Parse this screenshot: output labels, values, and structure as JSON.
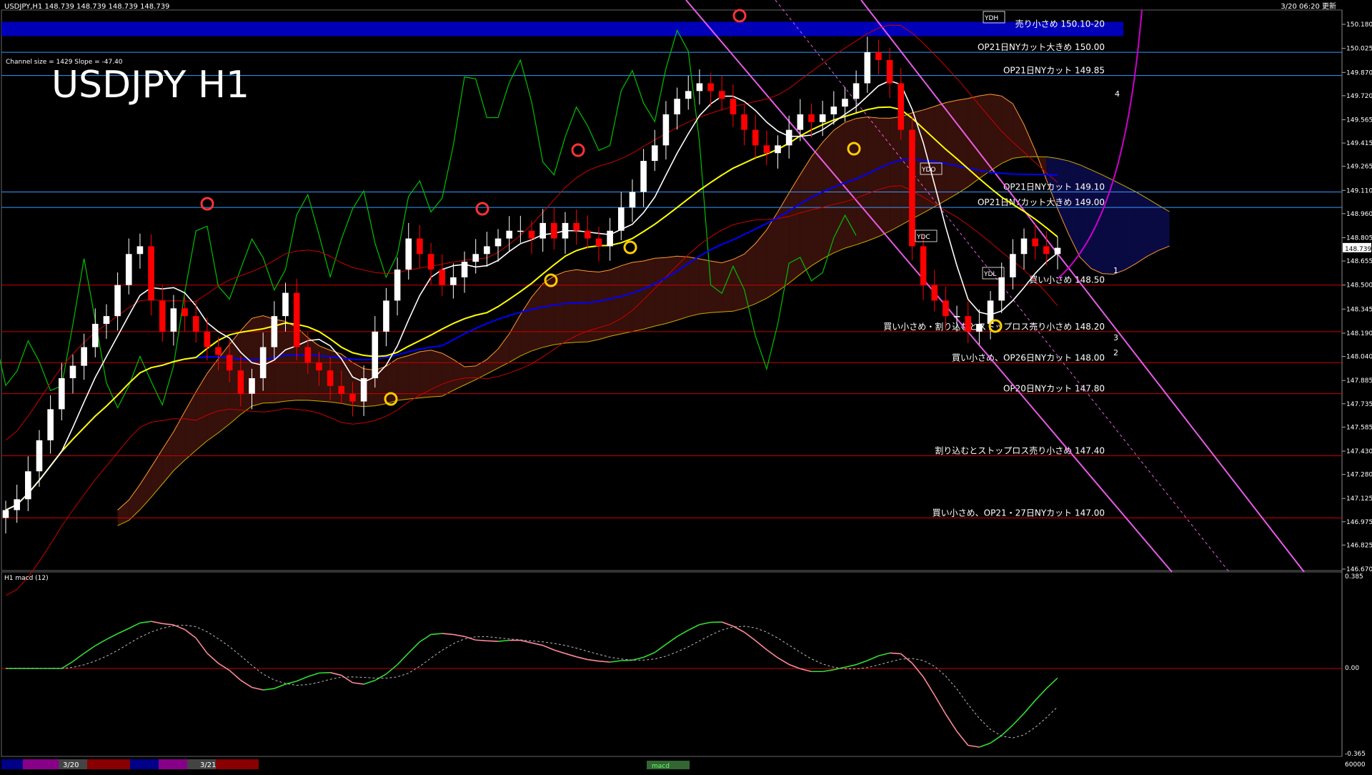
{
  "window": {
    "symbol_header": "USDJPY,H1  148.739 148.739 148.739 148.739",
    "timestamp": "3/20 06:20 更新",
    "channel_info": "Channel size = 1429  Slope = -47.40",
    "big_title": "USDJPY H1"
  },
  "macd_panel": {
    "label": "H1  macd (12)",
    "scale": [
      "0.385",
      "0.00",
      "-0.365"
    ],
    "volume_label": "60000"
  },
  "bottom_bar": {
    "date_labels": [
      "3/20",
      "3/21"
    ],
    "tab_label": "macd"
  },
  "colors": {
    "background": "#000000",
    "bull_candle": "#ffffff",
    "bear_candle": "#ff0000",
    "ma_fast": "#ffffff",
    "ma_mid": "#ffff00",
    "ma_slow": "#0000ff",
    "chikou": "#00c000",
    "channel": "#ff66ff",
    "macd_up": "#33dd33",
    "macd_down": "#ff8899",
    "signal": "#bbbbbb",
    "band_blue": "#0000cc"
  },
  "chart_data": {
    "type": "candlestick",
    "symbol": "USDJPY",
    "timeframe": "H1",
    "ylim": [
      146.67,
      150.18
    ],
    "y_ticks": [
      "150.180",
      "150.025",
      "149.870",
      "149.720",
      "149.565",
      "149.415",
      "149.265",
      "149.110",
      "148.960",
      "148.805",
      "148.655",
      "148.500",
      "148.345",
      "148.190",
      "148.040",
      "147.885",
      "147.735",
      "147.585",
      "147.430",
      "147.280",
      "147.125",
      "146.975",
      "146.825",
      "146.670"
    ],
    "current_price": "148.739",
    "levels": [
      {
        "price": 150.15,
        "text": "売り小さめ 150.10-20",
        "color": "#ffffff",
        "band": true
      },
      {
        "price": 150.0,
        "text": "OP21日NYカット大きめ 150.00",
        "color": "#3399ff"
      },
      {
        "price": 149.85,
        "text": "OP21日NYカット 149.85",
        "color": "#3399ff"
      },
      {
        "price": 149.1,
        "text": "OP21日NYカット 149.10",
        "color": "#3399ff"
      },
      {
        "price": 149.0,
        "text": "OP21日NYカット大きめ 149.00",
        "color": "#3399ff"
      },
      {
        "price": 148.5,
        "text": "買い小さめ 148.50",
        "color": "#cc0000"
      },
      {
        "price": 148.2,
        "text": "買い小さめ・割り込むとストップロス売り小さめ 148.20",
        "color": "#cc0000"
      },
      {
        "price": 148.0,
        "text": "買い小さめ、OP26日NYカット 148.00",
        "color": "#cc0000"
      },
      {
        "price": 147.8,
        "text": "OP20日NYカット 147.80",
        "color": "#cc0000"
      },
      {
        "price": 147.4,
        "text": "割り込むとストップロス売り小さめ 147.40",
        "color": "#cc0000"
      },
      {
        "price": 147.0,
        "text": "買い小さめ、OP21・27日NYカット 147.00",
        "color": "#cc0000"
      }
    ],
    "closes": [
      147.05,
      147.12,
      147.3,
      147.5,
      147.7,
      147.9,
      147.98,
      148.1,
      148.25,
      148.3,
      148.5,
      148.7,
      148.75,
      148.4,
      148.2,
      148.35,
      148.3,
      148.2,
      148.1,
      148.05,
      147.95,
      147.8,
      147.9,
      148.1,
      148.3,
      148.45,
      148.1,
      148.0,
      147.95,
      147.85,
      147.8,
      147.75,
      147.9,
      148.2,
      148.4,
      148.6,
      148.8,
      148.7,
      148.6,
      148.5,
      148.55,
      148.65,
      148.7,
      148.75,
      148.8,
      148.85,
      148.85,
      148.8,
      148.9,
      148.8,
      148.9,
      148.85,
      148.8,
      148.75,
      148.85,
      149.0,
      149.1,
      149.3,
      149.4,
      149.6,
      149.7,
      149.75,
      149.8,
      149.75,
      149.7,
      149.6,
      149.5,
      149.4,
      149.35,
      149.4,
      149.5,
      149.6,
      149.55,
      149.6,
      149.65,
      149.7,
      149.8,
      150.0,
      149.95,
      149.8,
      149.5,
      148.75,
      148.5,
      148.4,
      148.3,
      148.3,
      148.2,
      148.25,
      148.4,
      148.55,
      148.7,
      148.8,
      148.75,
      148.7,
      148.74
    ],
    "ichimoku_markers": [
      "YDH",
      "YDO",
      "YDC",
      "YDL"
    ],
    "projection_labels": [
      "1",
      "2",
      "3",
      "4"
    ]
  }
}
